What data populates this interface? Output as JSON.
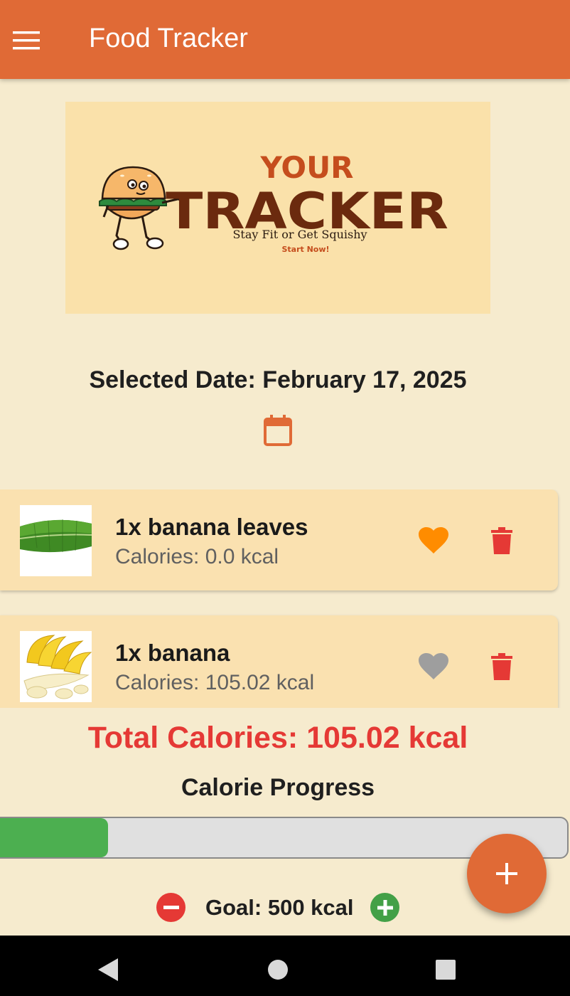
{
  "app_bar": {
    "title": "Food Tracker",
    "menu_icon": "hamburger-menu-icon",
    "background_color": "#e06a36"
  },
  "banner": {
    "line1": "YOUR",
    "line2": "TRACKER",
    "tagline": "Stay Fit or Get Squishy",
    "cta": "Start Now!",
    "mascot": "burger-mascot"
  },
  "date_section": {
    "selected_date": "Selected Date: February 17, 2025",
    "calendar_icon": "calendar-icon"
  },
  "food_entries": [
    {
      "name": "1x banana leaves",
      "calories": "Calories: 0.0 kcal",
      "favorite": true,
      "favorite_color": "#ff8c00",
      "image": "banana-leaf-image"
    },
    {
      "name": "1x banana",
      "calories": "Calories: 105.02 kcal",
      "favorite": false,
      "favorite_color": "#9e9e9e",
      "image": "banana-image"
    }
  ],
  "summary": {
    "total_calories": "Total Calories: 105.02 kcal",
    "progress_label": "Calorie Progress",
    "progress_fraction": 0.2,
    "goal": "Goal: 500 kcal",
    "total_color": "#e53935",
    "progress_color": "#4caf50"
  },
  "fab": {
    "icon": "plus-icon"
  },
  "navigation_bar": {
    "icons": [
      "back-icon",
      "home-icon",
      "recents-icon"
    ]
  }
}
